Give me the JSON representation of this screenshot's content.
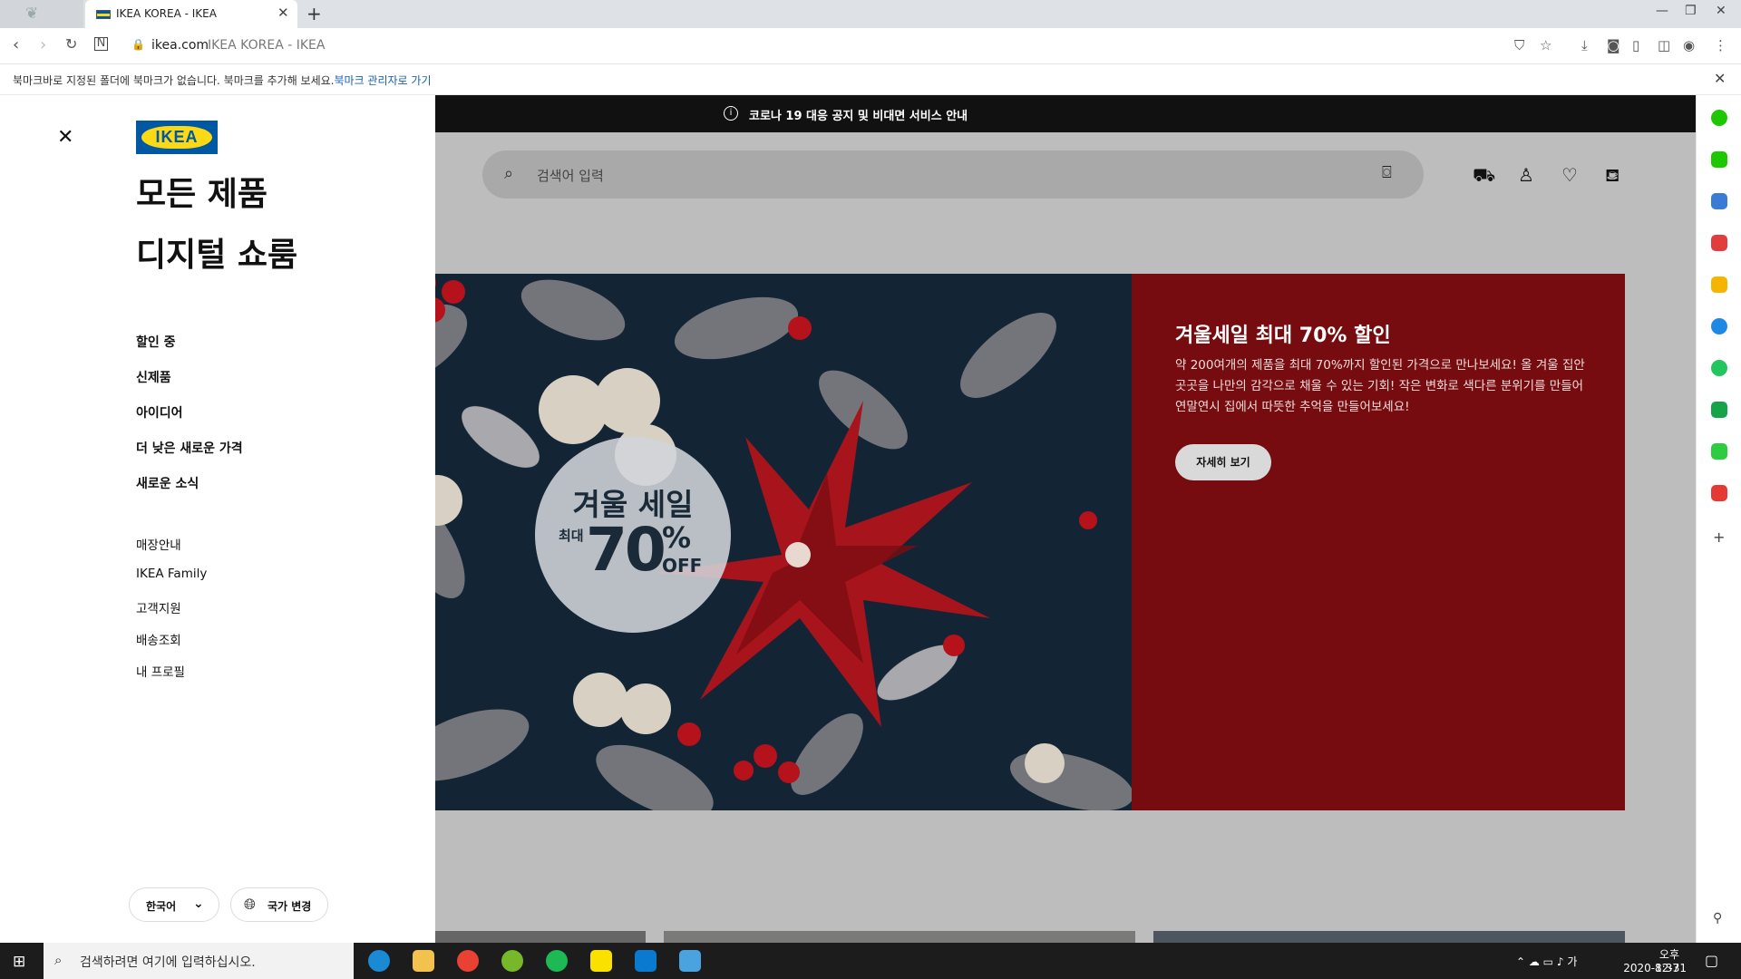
{
  "browser": {
    "tab_title": "IKEA KOREA - IKEA",
    "tab_close": "✕",
    "new_tab": "+",
    "url_host": "ikea.com",
    "url_title": "IKEA KOREA - IKEA",
    "bookmark_message": "북마크바로 지정된 폴더에 북마크가 없습니다. 북마크를 추가해 보세요.",
    "bookmark_link": "북마크 관리자로 가기"
  },
  "banner": {
    "text": "코로나 19 대응 공지 및 비대면 서비스 안내"
  },
  "search": {
    "placeholder": "검색어 입력"
  },
  "hero": {
    "badge_title": "겨울 세일",
    "badge_prefix": "최대",
    "badge_value": "70",
    "badge_percent": "%",
    "badge_off": "OFF",
    "title": "겨울세일 최대 70% 할인",
    "description": "약 200여개의 제품을 최대 70%까지 할인된 가격으로 만나보세요! 올 겨울 집안 곳곳을 나만의 감각으로 채울 수 있는 기회! 작은 변화로 색다른 분위기를 만들어 연말연시 집에서 따뜻한 추억을 만들어보세요!",
    "button": "자세히 보기",
    "colors": {
      "left_bg": "#132535",
      "right_bg": "#760c0f"
    }
  },
  "sidebar": {
    "logo": "IKEA",
    "primary": [
      "모든 제품",
      "디지털 쇼룸"
    ],
    "secondary": [
      "할인 중",
      "신제품",
      "아이디어",
      "더 낮은 새로운 가격",
      "새로운 소식"
    ],
    "tertiary": [
      "매장안내",
      "IKEA Family",
      "고객지원",
      "배송조회",
      "내 프로필"
    ],
    "language": "한국어",
    "country": "국가 변경"
  },
  "taskbar": {
    "search_placeholder": "검색하려면 여기에 입력하십시오.",
    "ime": "가",
    "time": "오후 8:37",
    "date": "2020-12-31"
  }
}
